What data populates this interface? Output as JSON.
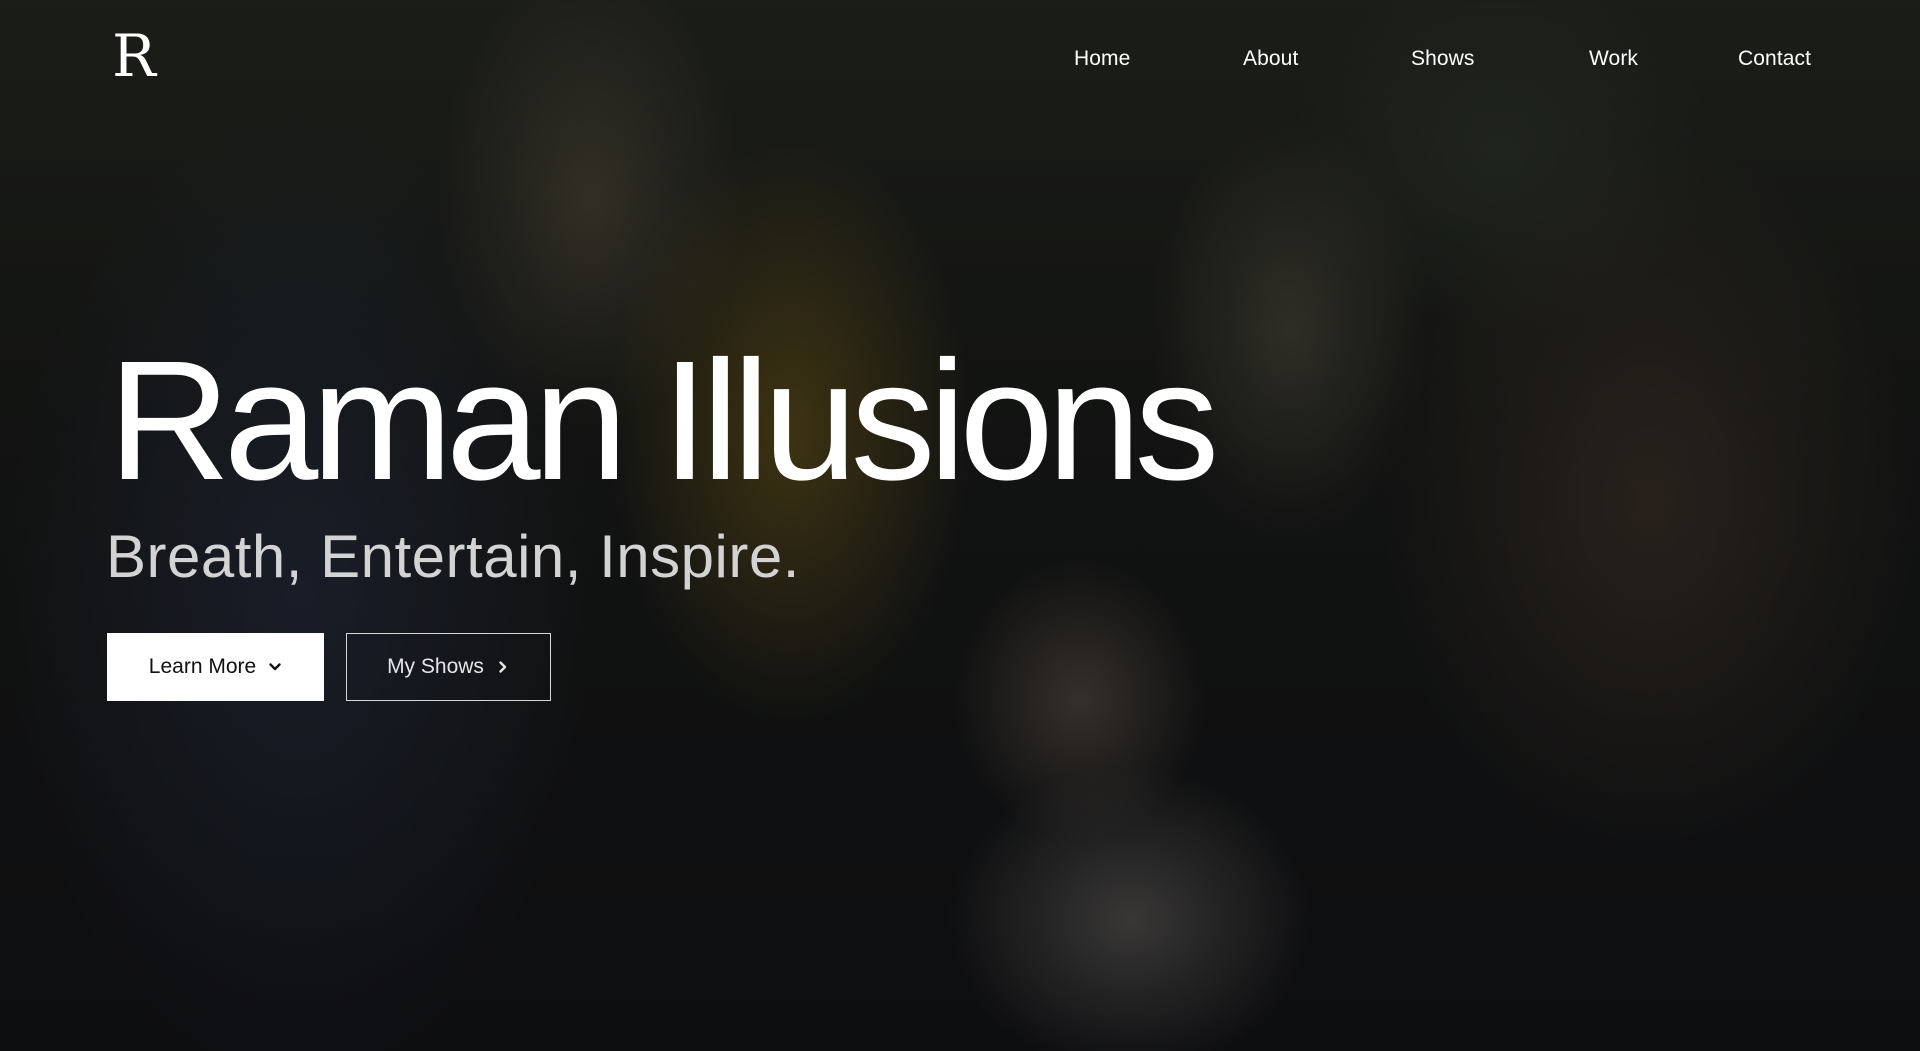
{
  "logo": {
    "letter": "R"
  },
  "nav": {
    "items": [
      {
        "label": "Home"
      },
      {
        "label": "About"
      },
      {
        "label": "Shows"
      },
      {
        "label": "Work"
      },
      {
        "label": "Contact"
      }
    ]
  },
  "hero": {
    "title": "Raman Illusions",
    "subtitle": "Breath, Entertain, Inspire.",
    "primary_button": {
      "label": "Learn More",
      "icon": "chevron-down-icon"
    },
    "secondary_button": {
      "label": "My Shows",
      "icon": "chevron-right-icon"
    }
  },
  "colors": {
    "text": "#ffffff",
    "subtitle": "#d3d3d3",
    "button_bg": "#ffffff",
    "button_text": "#111111"
  }
}
